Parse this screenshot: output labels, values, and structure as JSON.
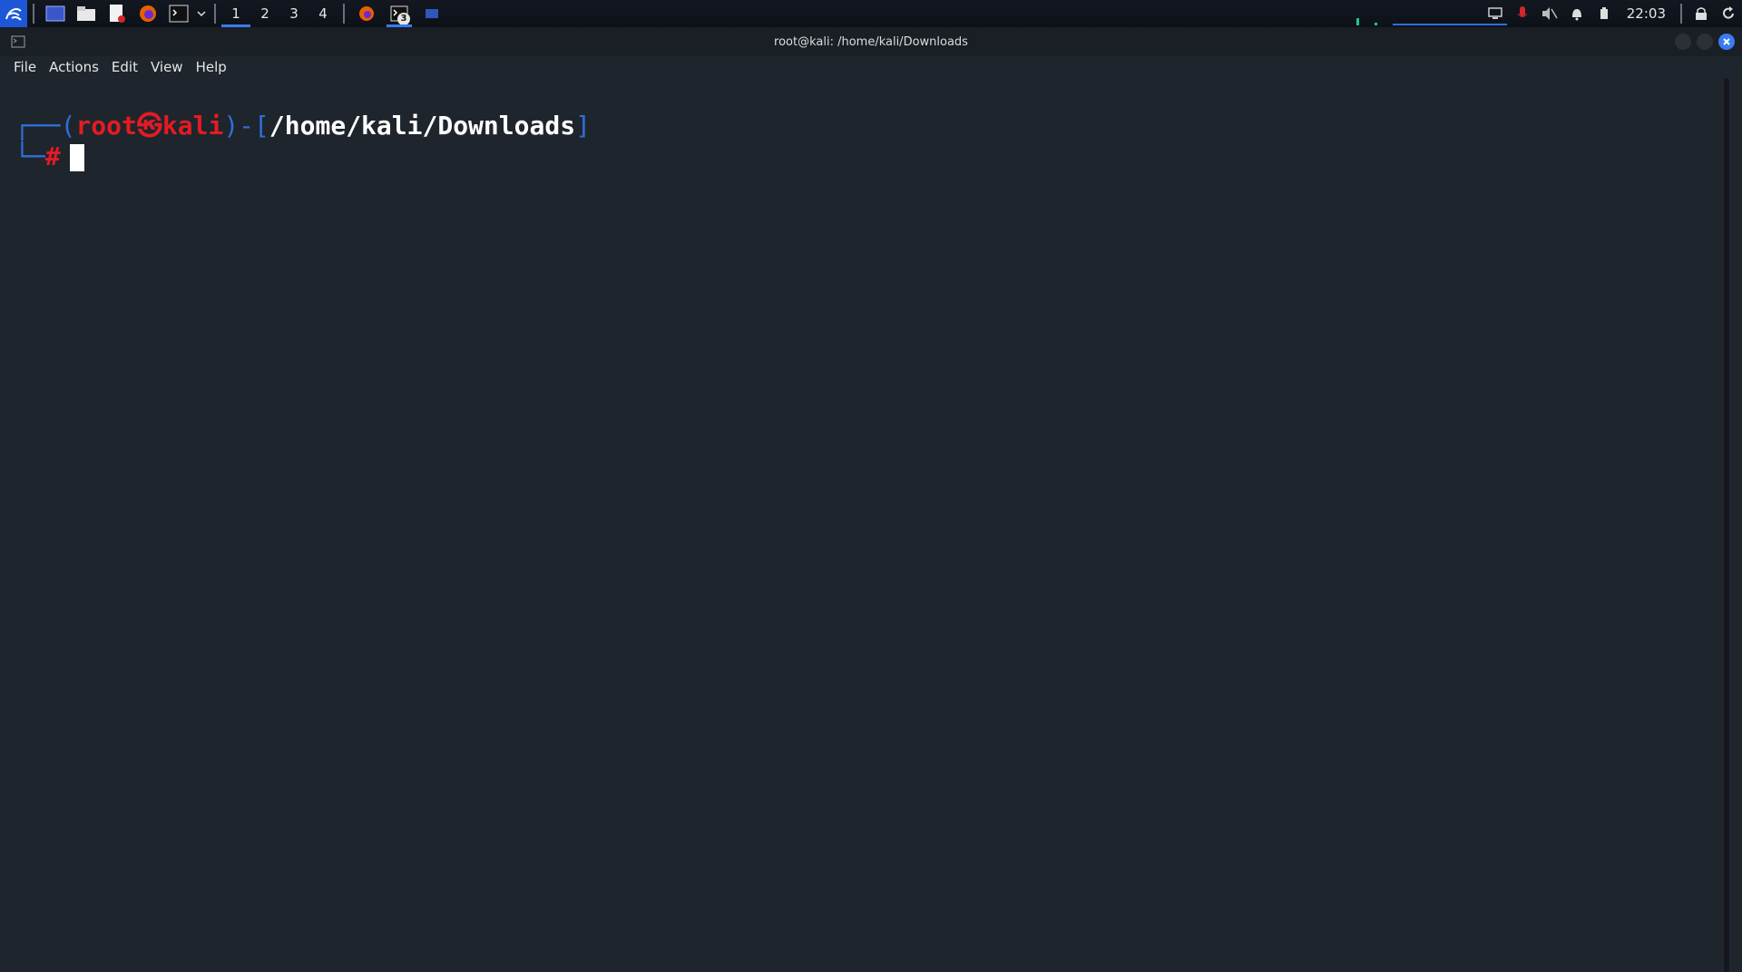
{
  "panel": {
    "workspaces": [
      "1",
      "2",
      "3",
      "4"
    ],
    "active_workspace": "1",
    "task_badge": "3",
    "clock": "22:03"
  },
  "window": {
    "title": "root@kali: /home/kali/Downloads"
  },
  "menu": {
    "file": "File",
    "actions": "Actions",
    "edit": "Edit",
    "view": "View",
    "help": "Help"
  },
  "terminal": {
    "prompt_open_paren": "┌──(",
    "user": "root",
    "at_symbol": "㉿",
    "host": "kali",
    "close_paren_bracket": ")-[",
    "path": "/home/kali/Downloads",
    "close_bracket": "]",
    "line2_prefix": "└─",
    "hash": "#"
  },
  "colors": {
    "accent": "#367bf0",
    "prompt_blue": "#2e6fd9",
    "prompt_red": "#e31b23",
    "background": "#1f252d"
  }
}
